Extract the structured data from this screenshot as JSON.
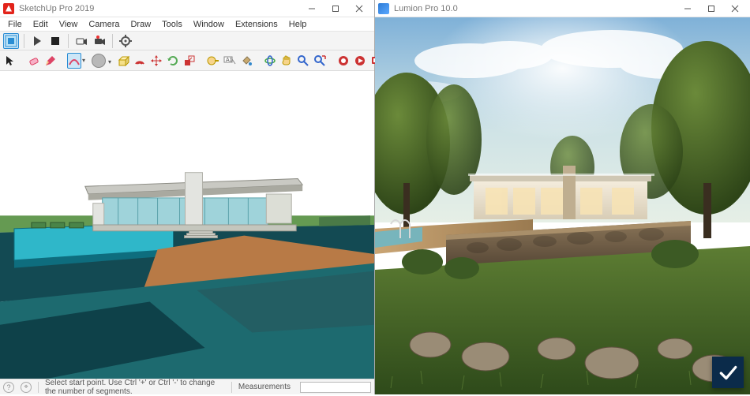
{
  "left": {
    "title": "SketchUp Pro 2019",
    "menus": [
      "File",
      "Edit",
      "View",
      "Camera",
      "Draw",
      "Tools",
      "Window",
      "Extensions",
      "Help"
    ],
    "status": {
      "hint": "Select start point. Use Ctrl '+' or Ctrl '-' to change the number of segments.",
      "measurements_label": "Measurements"
    }
  },
  "right": {
    "title": "Lumion Pro 10.0"
  },
  "colors": {
    "sky": "#ffffff",
    "grass_dark": "#0e4149",
    "grass_mid": "#1d6a6f",
    "grass_light": "#5a9b4e",
    "path": "#c58b52",
    "pool": "#2fb7c9",
    "pool_wall": "#0e6d7e",
    "house_glass": "#9fd3da",
    "house_wall": "#e3e4e0",
    "roof": "#c9c9c3",
    "lumion_sky_top": "#7fb1d8",
    "lumion_sky_bot": "#e6efe6",
    "lumion_grass": "#4a6a2a",
    "lumion_stone": "#6b5a49",
    "lumion_house": "#e8e0d2",
    "accent": "#2a8dd4"
  }
}
